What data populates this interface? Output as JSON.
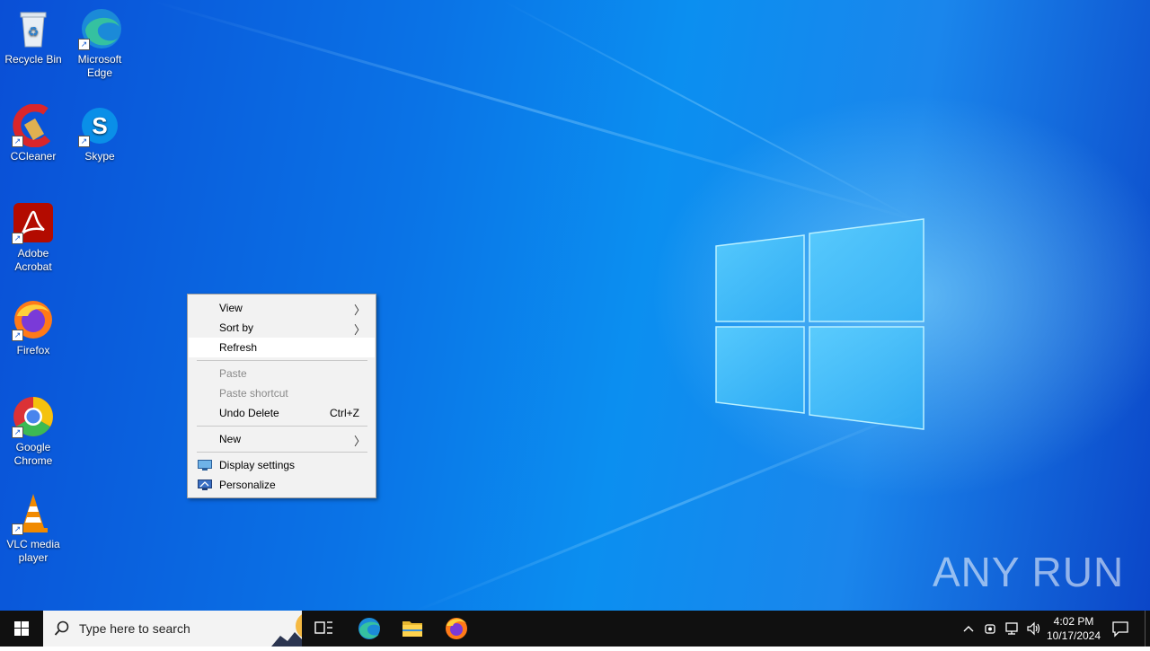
{
  "desktop_icons": [
    {
      "label": "Recycle Bin"
    },
    {
      "label": "Microsoft Edge"
    },
    {
      "label": "CCleaner"
    },
    {
      "label": "Skype"
    },
    {
      "label": "Adobe Acrobat"
    },
    {
      "label": "Firefox"
    },
    {
      "label": "Google Chrome"
    },
    {
      "label": "VLC media player"
    }
  ],
  "context_menu": {
    "view": "View",
    "sort_by": "Sort by",
    "refresh": "Refresh",
    "paste": "Paste",
    "paste_shortcut": "Paste shortcut",
    "undo_delete": "Undo Delete",
    "undo_delete_shortcut": "Ctrl+Z",
    "new": "New",
    "display_settings": "Display settings",
    "personalize": "Personalize"
  },
  "taskbar": {
    "search_placeholder": "Type here to search",
    "pinned": [
      "task-view",
      "microsoft-edge",
      "file-explorer",
      "firefox"
    ],
    "clock_time": "4:02 PM",
    "clock_date": "10/17/2024"
  },
  "watermark": "ANY RUN",
  "colors": {
    "desktop_accent": "#0b8ff0",
    "taskbar_bg": "#101010",
    "menu_bg": "#f2f2f2"
  }
}
